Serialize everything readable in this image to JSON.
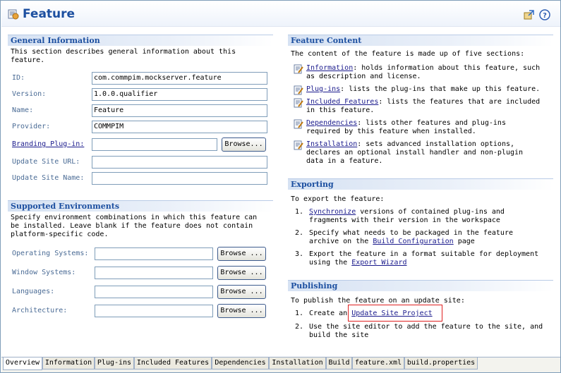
{
  "header": {
    "title": "Feature",
    "icons": [
      "feature-icon",
      "export-icon",
      "help-icon"
    ]
  },
  "general": {
    "heading": "General Information",
    "desc_line1": "This section describes general information about this",
    "desc_line2": "feature.",
    "fields": [
      {
        "label": "ID:",
        "value": "com.commpim.mockserver.feature"
      },
      {
        "label": "Version:",
        "value": "1.0.0.qualifier"
      },
      {
        "label": "Name:",
        "value": "Feature"
      },
      {
        "label": "Provider:",
        "value": "COMMPIM"
      },
      {
        "label": "Branding Plug-in:",
        "value": ""
      },
      {
        "label": "Update Site URL:",
        "value": ""
      },
      {
        "label": "Update Site Name:",
        "value": ""
      }
    ],
    "browse_label": "Browse..."
  },
  "environments": {
    "heading": "Supported Environments",
    "desc_line1": "Specify environment combinations in which this feature can",
    "desc_line2": "be installed. Leave blank if the feature does not contain",
    "desc_line3": "platform-specific code.",
    "fields": [
      {
        "label": "Operating Systems:",
        "value": ""
      },
      {
        "label": "Window Systems:",
        "value": ""
      },
      {
        "label": "Languages:",
        "value": ""
      },
      {
        "label": "Architecture:",
        "value": ""
      }
    ],
    "browse_label": "Browse ..."
  },
  "content": {
    "heading": "Feature Content",
    "intro": "The content of the feature is made up of five sections:",
    "items": [
      {
        "link": "Information",
        "line1": ": holds information about this feature, such",
        "line2": "as description and license."
      },
      {
        "link": "Plug-ins",
        "line1": ": lists the plug-ins that make up this feature.",
        "line2": ""
      },
      {
        "link": "Included Features",
        "line1": ": lists the features that are included",
        "line2": "in this feature."
      },
      {
        "link": "Dependencies",
        "line1": ": lists other features and plug-ins",
        "line2": "required by this feature when installed."
      },
      {
        "link": "Installation",
        "line1": ": sets advanced installation options,",
        "line2": "declares an optional install handler and non-plugin",
        "line3": "data in a feature."
      }
    ]
  },
  "exporting": {
    "heading": "Exporting",
    "intro": "To export the feature:",
    "steps": [
      {
        "num": "1.",
        "link": "Synchronize",
        "line1": " versions of contained plug-ins and",
        "line2": "fragments with their version in the workspace"
      },
      {
        "num": "2.",
        "pre": "Specify what needs to be packaged in the feature",
        "line2pre": "archive on the ",
        "link": "Build Configuration",
        "line2post": " page"
      },
      {
        "num": "3.",
        "pre": "Export the feature in a format suitable for deployment",
        "line2pre": "using the ",
        "link": "Export Wizard",
        "line2post": ""
      }
    ]
  },
  "publishing": {
    "heading": "Publishing",
    "intro": "To publish the feature on an update site:",
    "steps": [
      {
        "num": "1.",
        "pre": "Create an ",
        "link": "Update Site Project"
      },
      {
        "num": "2.",
        "line1": "Use the site editor to add the feature to the site, and",
        "line2": "build the site"
      }
    ]
  },
  "tabs": [
    "Overview",
    "Information",
    "Plug-ins",
    "Included Features",
    "Dependencies",
    "Installation",
    "Build",
    "feature.xml",
    "build.properties"
  ],
  "colors": {
    "title": "#1c4fa0",
    "section_heading": "#1c4fa0",
    "link": "#1a1a8c",
    "label": "#4a6b95",
    "highlight": "#e02020"
  }
}
